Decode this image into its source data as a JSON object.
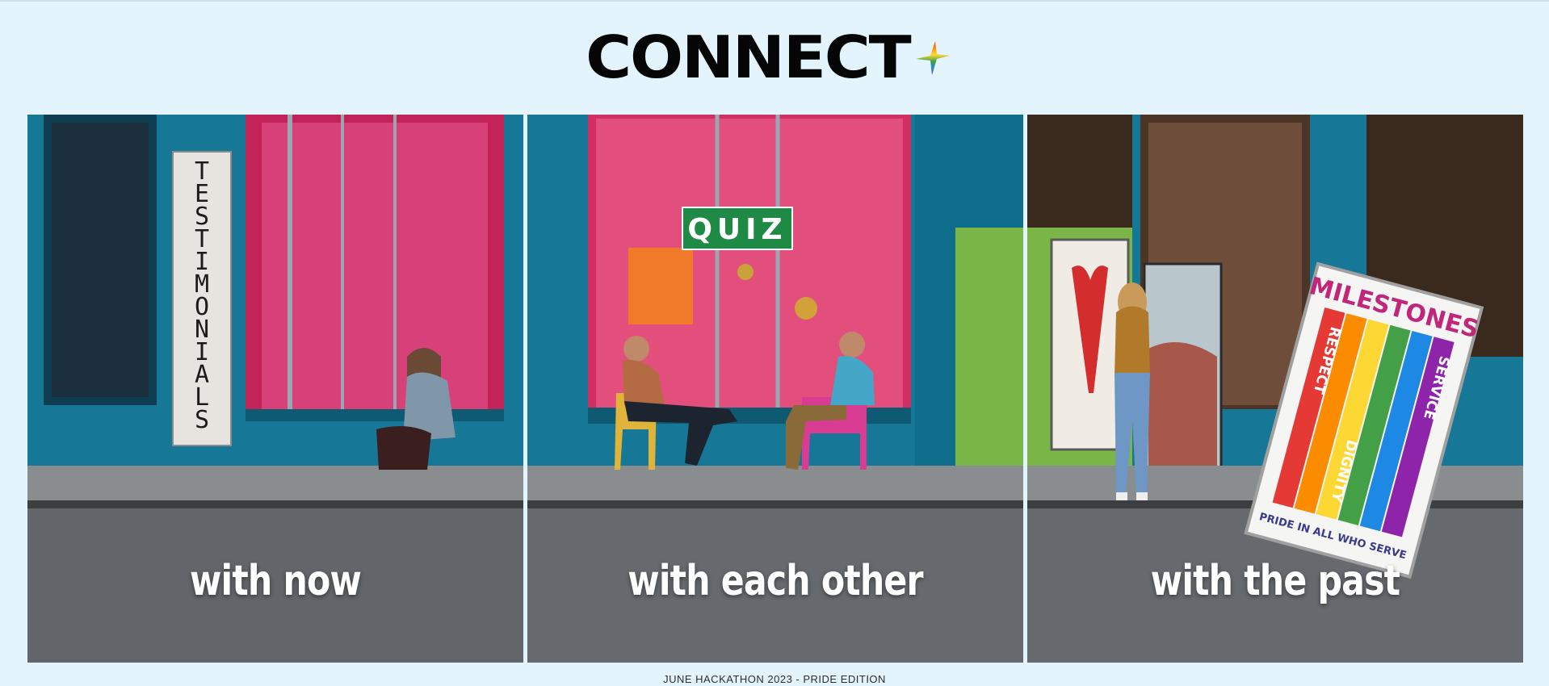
{
  "header": {
    "title": "CONNECT",
    "icon": "rainbow-sparkle-icon"
  },
  "panels": [
    {
      "caption": "with now",
      "sign": "TESTIMONIALS",
      "sign_letters": [
        "T",
        "E",
        "S",
        "T",
        "I",
        "M",
        "O",
        "N",
        "I",
        "A",
        "L",
        "S"
      ]
    },
    {
      "caption": "with each other",
      "sign": "QUIZ"
    },
    {
      "caption": "with the past",
      "sign": "MILESTONES",
      "poster_words": [
        "RESPECT",
        "DIGNITY",
        "SERVICE"
      ],
      "poster_footer": "PRIDE IN ALL WHO SERVE"
    }
  ],
  "footer": {
    "text": "JUNE HACKATHON 2023 - PRIDE EDITION"
  },
  "colors": {
    "background": "#e3f4fd",
    "storefront_teal": "#157a9a",
    "window_pink": "#d4386a",
    "quiz_green": "#1e8a45",
    "rainbow": [
      "#e53935",
      "#fb8c00",
      "#fdd835",
      "#43a047",
      "#1e88e5",
      "#8e24aa"
    ]
  }
}
